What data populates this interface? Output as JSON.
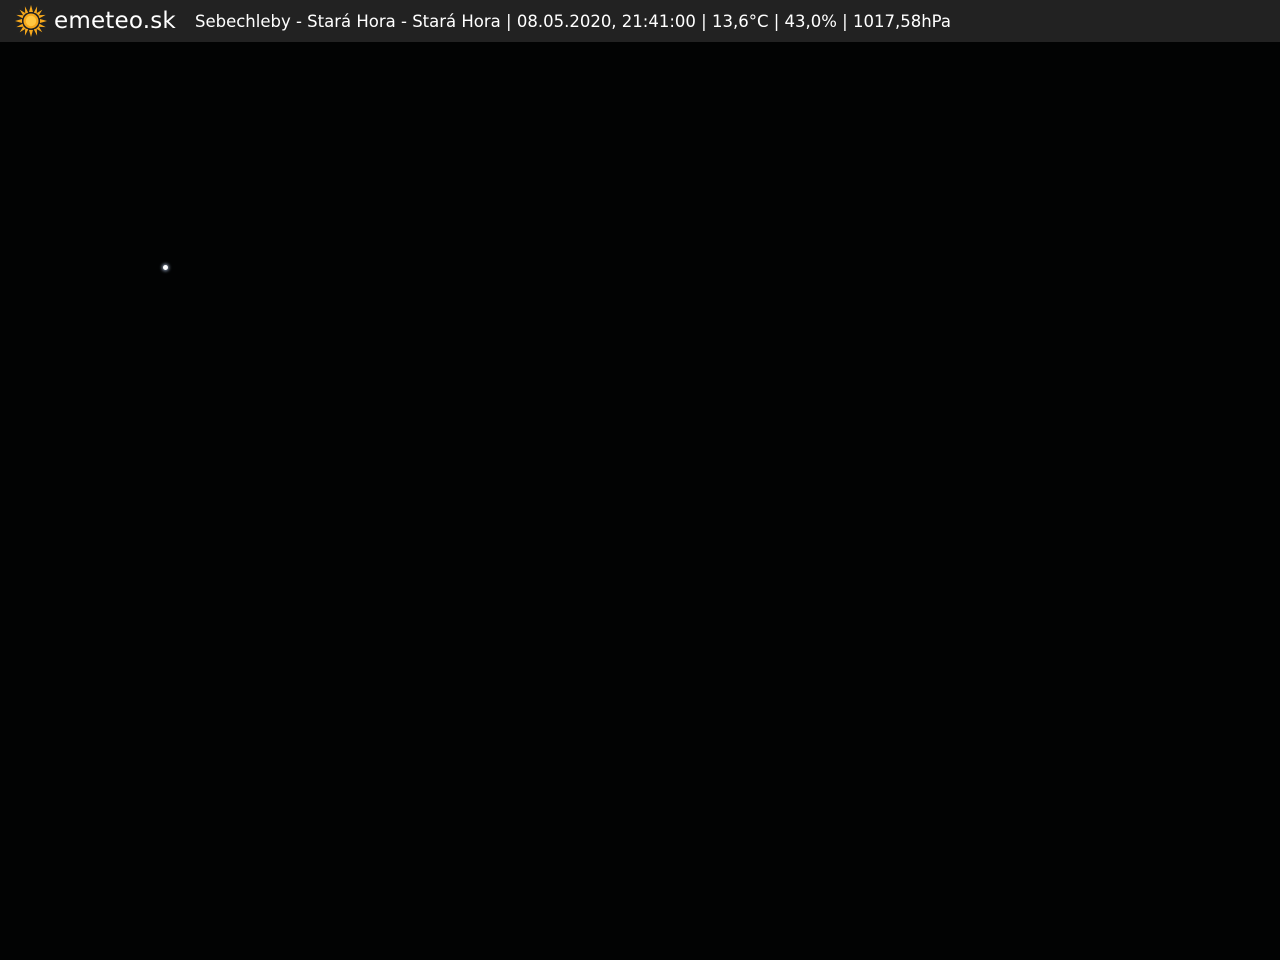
{
  "header": {
    "brand": "emeteo.sk",
    "logo_icon": "sun-icon",
    "logo_color": "#f6a81c",
    "info": "Sebechleby - Stará Hora - Stará Hora | 08.05.2020, 21:41:00 | 13,6°C | 43,0% | 1017,58hPa"
  },
  "scene": {
    "description_color": "#020303"
  }
}
